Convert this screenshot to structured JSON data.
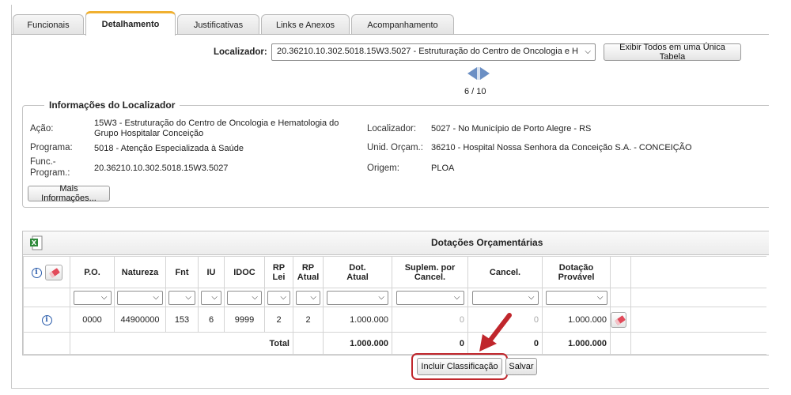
{
  "tabs": [
    {
      "label": "Funcionais"
    },
    {
      "label": "Detalhamento",
      "active": true
    },
    {
      "label": "Justificativas"
    },
    {
      "label": "Links e Anexos"
    },
    {
      "label": "Acompanhamento"
    }
  ],
  "locator": {
    "label": "Localizador:",
    "selected": "20.36210.10.302.5018.15W3.5027 - Estruturação do Centro de Oncologia e H",
    "show_all_label": "Exibir Todos em uma Única Tabela",
    "page_indicator": "6 / 10"
  },
  "info": {
    "legend": "Informações do Localizador",
    "acao_label": "Ação:",
    "acao_value_1": "15W3 - Estruturação do Centro de Oncologia e Hematologia do",
    "acao_value_2": "Grupo Hospitalar Conceição",
    "programa_label": "Programa:",
    "programa_value": "5018 - Atenção Especializada à Saúde",
    "func_label_1": "Func.-",
    "func_label_2": "Program.:",
    "func_value": "20.36210.10.302.5018.15W3.5027",
    "localizador_label": "Localizador:",
    "localizador_value": "5027 - No Município de Porto Alegre - RS",
    "unid_label": "Unid. Orçam.:",
    "unid_value": "36210 - Hospital Nossa Senhora da Conceição S.A. - CONCEIÇÃO",
    "origem_label": "Origem:",
    "origem_value": "PLOA",
    "more_label": "Mais Informações..."
  },
  "table": {
    "title": "Dotações Orçamentárias",
    "headers": {
      "po": "P.O.",
      "natureza": "Natureza",
      "fnt": "Fnt",
      "iu": "IU",
      "idoc": "IDOC",
      "rplei_1": "RP",
      "rplei_2": "Lei",
      "rpatual_1": "RP",
      "rpatual_2": "Atual",
      "dot_1": "Dot.",
      "dot_2": "Atual",
      "suplem_1": "Suplem. por",
      "suplem_2": "Cancel.",
      "cancel": "Cancel.",
      "dotprov_1": "Dotação",
      "dotprov_2": "Provável"
    },
    "row": {
      "po": "0000",
      "natureza": "44900000",
      "fnt": "153",
      "iu": "6",
      "idoc": "9999",
      "rp_lei": "2",
      "rp_atual": "2",
      "dot_atual": "1.000.000",
      "suplem": "0",
      "cancel": "0",
      "dot_provavel": "1.000.000"
    },
    "total": {
      "label": "Total",
      "dot_atual": "1.000.000",
      "suplem": "0",
      "cancel": "0",
      "dot_provavel": "1.000.000"
    }
  },
  "actions": {
    "incluir_label": "Incluir Classificação",
    "salvar_label": "Salvar"
  },
  "colors": {
    "active_tab_accent": "#f0b030",
    "highlight": "#c0262c",
    "info_icon": "#2a5cab"
  }
}
